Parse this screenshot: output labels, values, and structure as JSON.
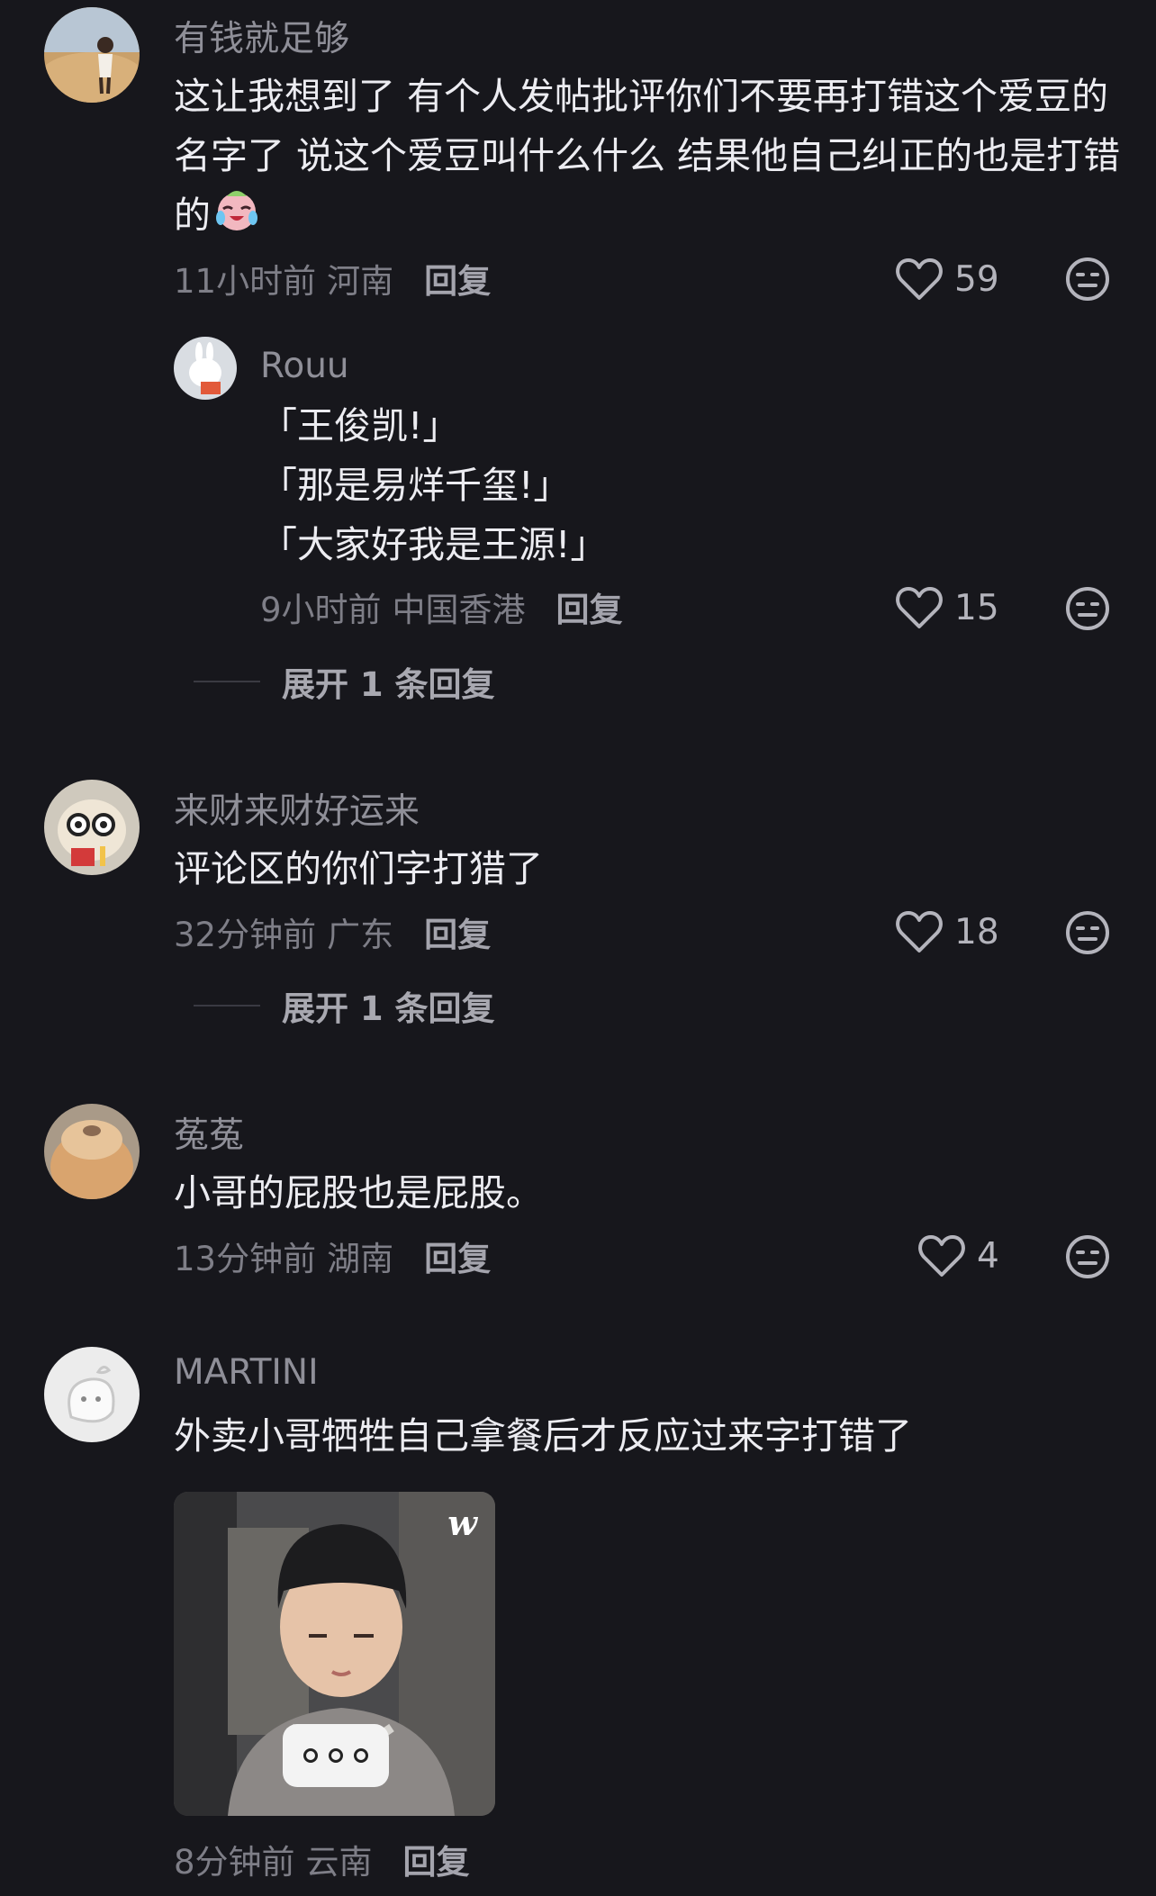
{
  "comments": [
    {
      "username": "有钱就足够",
      "text": "这让我想到了 有个人发帖批评你们不要再打错这个爱豆的名字了 说这个爱豆叫什么什么 结果他自己纠正的也是打错的",
      "emoji": "crying-laughing-emoji",
      "time": "11小时前",
      "location": "河南",
      "reply": "回复",
      "likes": "59"
    },
    {
      "username": "Rouu",
      "lines": [
        "「王俊凯!」",
        "「那是易烊千玺!」",
        "「大家好我是王源!」"
      ],
      "time": "9小时前",
      "location": "中国香港",
      "reply": "回复",
      "likes": "15",
      "expand": "展开 1 条回复"
    },
    {
      "username": "来财来财好运来",
      "text": "评论区的你们字打猎了",
      "time": "32分钟前",
      "location": "广东",
      "reply": "回复",
      "likes": "18",
      "expand": "展开 1 条回复"
    },
    {
      "username": "菟菟",
      "text": "小哥的屁股也是屁股。",
      "time": "13分钟前",
      "location": "湖南",
      "reply": "回复",
      "likes": "4"
    },
    {
      "username": "MARTINI",
      "text": "外卖小哥牺牲自己拿餐后才反应过来字打错了",
      "time": "8分钟前",
      "location": "云南",
      "reply": "回复",
      "image_watermark": "w"
    }
  ],
  "icons": {
    "like": "heart-outline-icon",
    "dislike": "neutral-face-icon",
    "more": "more-dots-icon"
  },
  "colors": {
    "background": "#17171c",
    "text": "#ececf1",
    "secondary": "#8f8f98"
  }
}
